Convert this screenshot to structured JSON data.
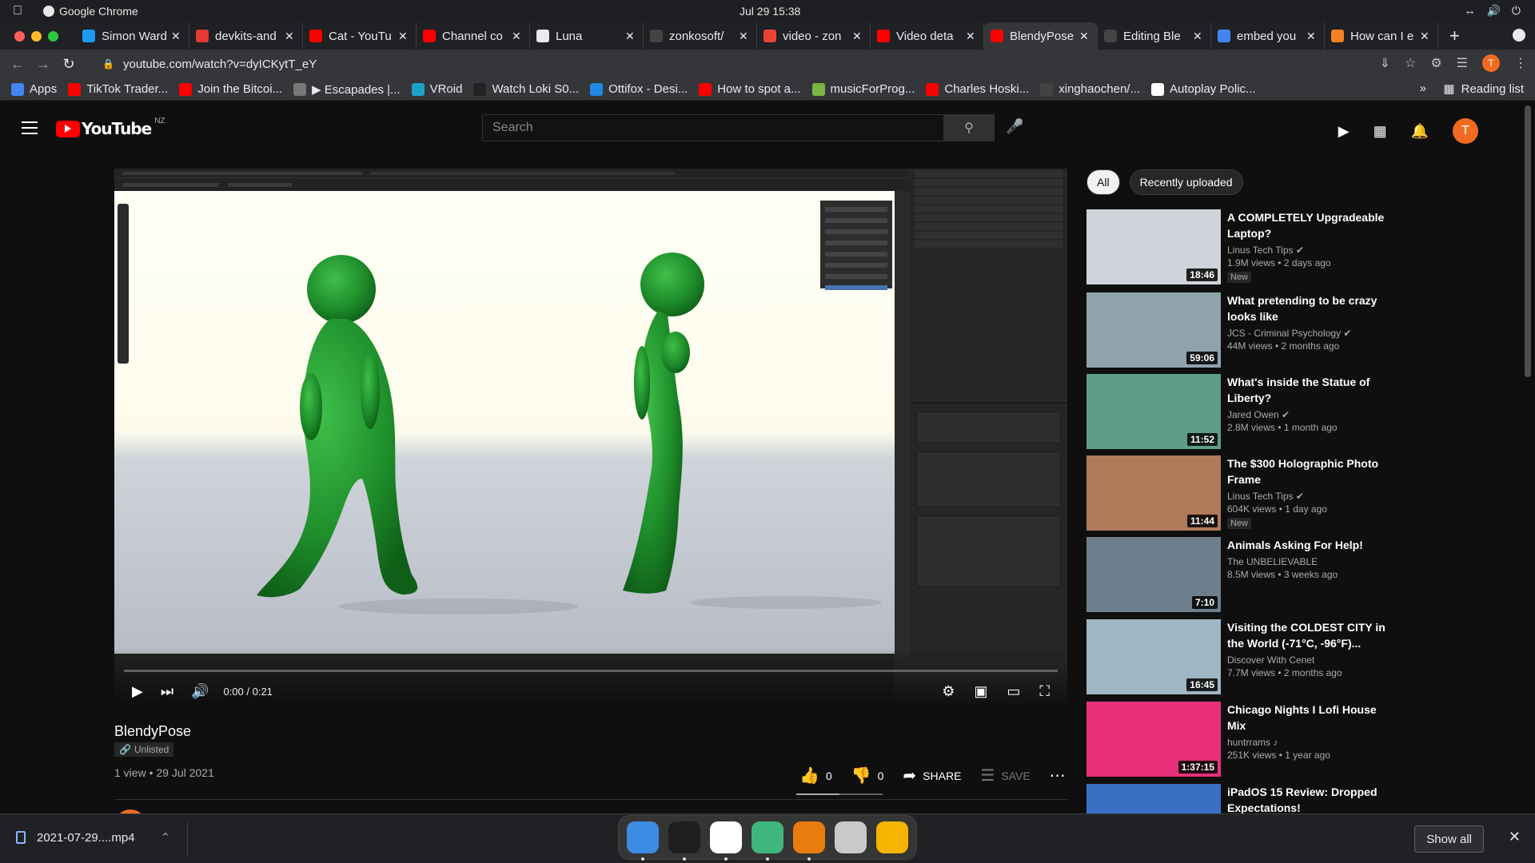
{
  "menubar": {
    "app_name": "Google Chrome",
    "clock": "Jul 29  15:38"
  },
  "tabs": [
    {
      "title": "Simon Ward",
      "color": "#1d9bf0"
    },
    {
      "title": "devkits-and",
      "color": "#e53935"
    },
    {
      "title": "Cat - YouTu",
      "color": "#ff0000"
    },
    {
      "title": "Channel co",
      "color": "#ff0000"
    },
    {
      "title": "Luna",
      "color": "#e8eaed"
    },
    {
      "title": "zonkosoft/",
      "color": "#444444"
    },
    {
      "title": "video - zon",
      "color": "#ea4335"
    },
    {
      "title": "Video deta",
      "color": "#ff0000"
    },
    {
      "title": "BlendyPose",
      "color": "#ff0000",
      "active": true
    },
    {
      "title": "Editing Ble",
      "color": "#444444"
    },
    {
      "title": "embed you",
      "color": "#4285f4"
    },
    {
      "title": "How can I e",
      "color": "#f48024"
    }
  ],
  "address": {
    "url": "youtube.com/watch?v=dyICKytT_eY",
    "profile_initial": "T"
  },
  "bookmarks": [
    {
      "label": "Apps",
      "color": "#4285f4"
    },
    {
      "label": "TikTok Trader...",
      "color": "#ff0000"
    },
    {
      "label": "Join the Bitcoi...",
      "color": "#ff0000"
    },
    {
      "label": "▶ Escapades |...",
      "color": "#777777"
    },
    {
      "label": "VRoid",
      "color": "#1aa3c9"
    },
    {
      "label": "Watch Loki S0...",
      "color": "#222222"
    },
    {
      "label": "Ottifox - Desi...",
      "color": "#1e88e5"
    },
    {
      "label": "How to spot a...",
      "color": "#ff0000"
    },
    {
      "label": "musicForProg...",
      "color": "#7cb342"
    },
    {
      "label": "Charles Hoski...",
      "color": "#ff0000"
    },
    {
      "label": "xinghaochen/...",
      "color": "#444444"
    },
    {
      "label": "Autoplay Polic...",
      "color": "#ffffff"
    }
  ],
  "bookmarks_more": "»",
  "reading_list": "Reading list",
  "youtube": {
    "logo": "YouTube",
    "country": "NZ",
    "search_placeholder": "Search",
    "avatar_initial": "T"
  },
  "player": {
    "time": "0:00 / 0:21",
    "progress": 0.0
  },
  "video": {
    "title": "BlendyPose",
    "visibility": "Unlisted",
    "meta": "1 view • 29 Jul 2021",
    "likes": "0",
    "dislikes": "0",
    "share": "SHARE",
    "save": "SAVE"
  },
  "chips": [
    {
      "label": "All",
      "selected": true
    },
    {
      "label": "Recently uploaded",
      "selected": false
    }
  ],
  "recommendations": [
    {
      "title": "A COMPLETELY Upgradeable Laptop?",
      "channel": "Linus Tech Tips",
      "verified": true,
      "stats": "1.9M views • 2 days ago",
      "badge": "New",
      "duration": "18:46",
      "thumb": "#cfd4da"
    },
    {
      "title": "What pretending to be crazy looks like",
      "channel": "JCS - Criminal Psychology",
      "verified": true,
      "stats": "44M views • 2 months ago",
      "badge": "",
      "duration": "59:06",
      "thumb": "#8fa3ad"
    },
    {
      "title": "What's inside the Statue of Liberty?",
      "channel": "Jared Owen",
      "verified": true,
      "stats": "2.8M views • 1 month ago",
      "badge": "",
      "duration": "11:52",
      "thumb": "#5e9e86"
    },
    {
      "title": "The $300 Holographic Photo Frame",
      "channel": "Linus Tech Tips",
      "verified": true,
      "stats": "604K views • 1 day ago",
      "badge": "New",
      "duration": "11:44",
      "thumb": "#b07a5a"
    },
    {
      "title": "Animals Asking For Help!",
      "channel": "The UNBELIEVABLE",
      "verified": false,
      "stats": "8.5M views • 3 weeks ago",
      "badge": "",
      "duration": "7:10",
      "thumb": "#6d7f8c"
    },
    {
      "title": "Visiting the COLDEST CITY in the World (-71°C, -96°F)...",
      "channel": "Discover With Cenet",
      "verified": false,
      "stats": "7.7M views • 2 months ago",
      "badge": "",
      "duration": "16:45",
      "thumb": "#9fb6c4"
    },
    {
      "title": "Chicago Nights I Lofi House Mix",
      "channel": "huntrrams ♪",
      "verified": false,
      "stats": "251K views • 1 year ago",
      "badge": "",
      "duration": "1:37:15",
      "thumb": "#e8307a"
    },
    {
      "title": "iPadOS 15 Review: Dropped Expectations!",
      "channel": "",
      "verified": false,
      "stats": "",
      "badge": "",
      "duration": "",
      "thumb": "#3a6fc4"
    }
  ],
  "download": {
    "filename": "2021-07-29....mp4",
    "show_all": "Show all"
  },
  "dock": [
    {
      "name": "finder",
      "color": "#3d8ce4",
      "running": true
    },
    {
      "name": "terminal",
      "color": "#1e1e1e",
      "running": true
    },
    {
      "name": "chrome",
      "color": "#ffffff",
      "running": true
    },
    {
      "name": "atom",
      "color": "#3fb67c",
      "running": true
    },
    {
      "name": "blender",
      "color": "#e87d0d",
      "running": true
    },
    {
      "name": "trash",
      "color": "#c9c9c9",
      "running": false
    },
    {
      "name": "launchpad",
      "color": "#f4b400",
      "running": false
    }
  ]
}
